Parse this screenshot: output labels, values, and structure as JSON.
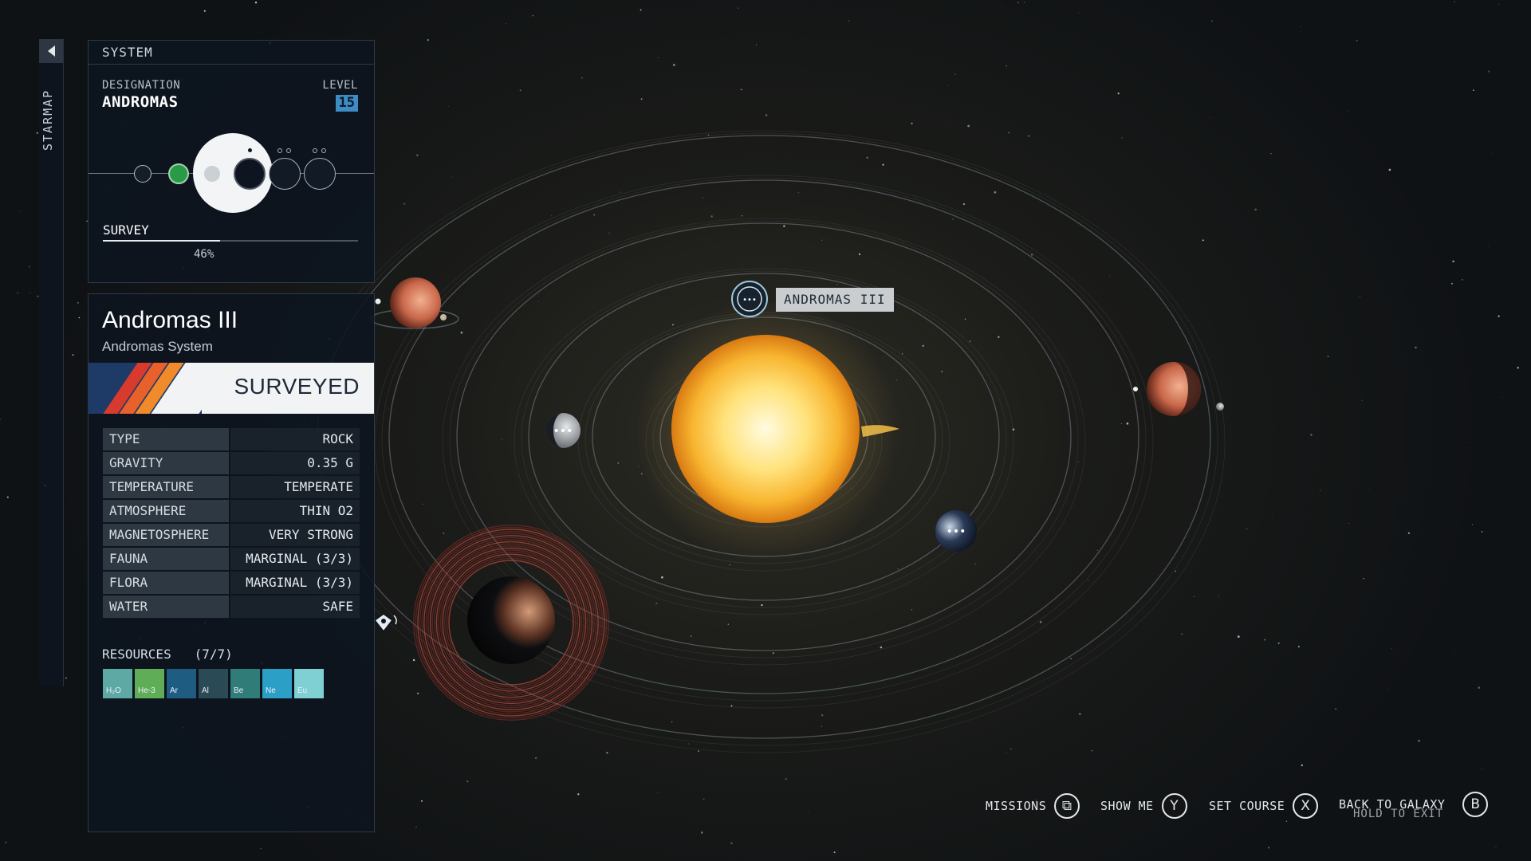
{
  "sidebar": {
    "tab_label": "STARMAP",
    "collapse_icon": "chevron-left-icon"
  },
  "system_panel": {
    "header": "SYSTEM",
    "designation_label": "DESIGNATION",
    "designation": "ANDROMAS",
    "level_label": "LEVEL",
    "level": "15",
    "survey_label": "SURVEY",
    "survey_percent_text": "46%",
    "survey_progress": 0.46
  },
  "planet_panel": {
    "name": "Andromas III",
    "system": "Andromas System",
    "status": "SURVEYED",
    "attributes": [
      {
        "key": "TYPE",
        "value": "ROCK"
      },
      {
        "key": "GRAVITY",
        "value": "0.35 G"
      },
      {
        "key": "TEMPERATURE",
        "value": "TEMPERATE"
      },
      {
        "key": "ATMOSPHERE",
        "value": "THIN O2"
      },
      {
        "key": "MAGNETOSPHERE",
        "value": "VERY STRONG"
      },
      {
        "key": "FAUNA",
        "value": "MARGINAL (3/3)"
      },
      {
        "key": "FLORA",
        "value": "MARGINAL (3/3)"
      },
      {
        "key": "WATER",
        "value": "SAFE"
      }
    ],
    "resources_label": "RESOURCES",
    "resources_count": "(7/7)",
    "resources": [
      {
        "symbol": "H₂O",
        "color": "#5fa9a4"
      },
      {
        "symbol": "He-3",
        "color": "#5fae57"
      },
      {
        "symbol": "Ar",
        "color": "#1e5c82"
      },
      {
        "symbol": "Al",
        "color": "#2a4a55"
      },
      {
        "symbol": "Be",
        "color": "#2f7c78"
      },
      {
        "symbol": "Ne",
        "color": "#2b9fc6"
      },
      {
        "symbol": "Eu",
        "color": "#7ed0d2"
      }
    ]
  },
  "map": {
    "selected_planet_tag": "ANDROMAS III",
    "tag_icon": "scan-icon"
  },
  "controls": {
    "missions": {
      "label": "MISSIONS",
      "key": "⧉"
    },
    "show_me": {
      "label": "SHOW ME",
      "key": "Y"
    },
    "set_course": {
      "label": "SET COURSE",
      "key": "X"
    },
    "back": {
      "label": "BACK TO GALAXY",
      "sub": "HOLD TO EXIT",
      "key": "B"
    }
  },
  "colors": {
    "panel_bg": "#0c1420",
    "level_badge": "#3d8dc4",
    "sun": "#ffd04a",
    "accent_green": "#2a9a48"
  }
}
